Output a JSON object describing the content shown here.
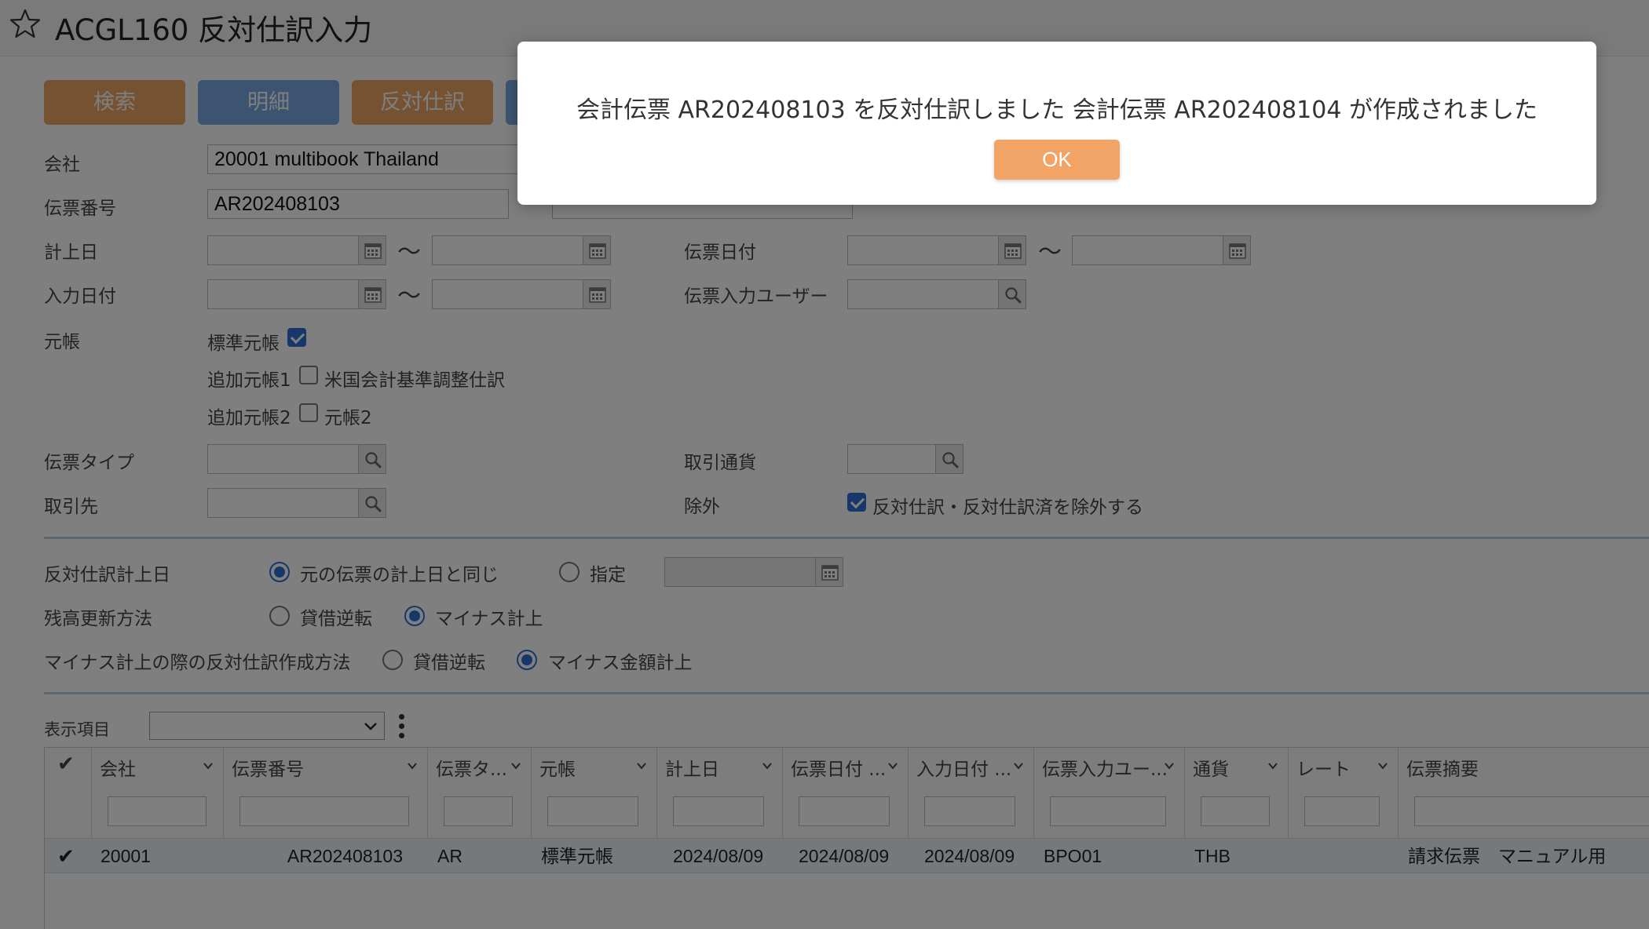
{
  "header": {
    "title": "ACGL160 反対仕訳入力"
  },
  "toolbar": {
    "search": "検索",
    "detail": "明細",
    "reverse": "反対仕訳"
  },
  "form": {
    "company_label": "会社",
    "company_value": "20001 multibook Thailand",
    "voucher_no_label": "伝票番号",
    "voucher_no_value": "AR202408103",
    "posting_date_label": "計上日",
    "entry_date_label": "入力日付",
    "voucher_date_label": "伝票日付",
    "entry_user_label": "伝票入力ユーザー",
    "ledger_label": "元帳",
    "ledgers": [
      {
        "name": "標準元帳",
        "checked": true,
        "desc": ""
      },
      {
        "name": "追加元帳1",
        "checked": false,
        "desc": "米国会計基準調整仕訳"
      },
      {
        "name": "追加元帳2",
        "checked": false,
        "desc": "元帳2"
      }
    ],
    "voucher_type_label": "伝票タイプ",
    "partner_label": "取引先",
    "currency_label": "取引通貨",
    "exclude_label": "除外",
    "exclude_option": "反対仕訳・反対仕訳済を除外する",
    "tilde": "〜"
  },
  "reverse_settings": {
    "date_label": "反対仕訳計上日",
    "date_same": "元の伝票の計上日と同じ",
    "date_specify": "指定",
    "balance_label": "残高更新方法",
    "balance_dc": "貸借逆転",
    "balance_minus": "マイナス計上",
    "minus_method_label": "マイナス計上の際の反対仕訳作成方法",
    "minus_dc": "貸借逆転",
    "minus_amount": "マイナス金額計上"
  },
  "display": {
    "label": "表示項目"
  },
  "grid": {
    "check_mark": "✔",
    "columns": [
      "会社",
      "伝票番号",
      "伝票タ...",
      "元帳",
      "計上日",
      "伝票日付 ...",
      "入力日付 ...",
      "伝票入力ユー...",
      "通貨",
      "レート",
      "伝票摘要"
    ],
    "rows": [
      {
        "company": "20001",
        "voucher_no": "AR202408103",
        "type": "AR",
        "ledger": "標準元帳",
        "posting_date": "2024/08/09",
        "voucher_date": "2024/08/09",
        "entry_date": "2024/08/09",
        "user": "BPO01",
        "currency": "THB",
        "rate": "",
        "summary": "請求伝票　マニュアル用"
      }
    ]
  },
  "modal": {
    "message": "会計伝票 AR202408103 を反対仕訳しました 会計伝票 AR202408104 が作成されました",
    "ok_label": "OK"
  },
  "colors": {
    "orange_button": "#e8a465",
    "blue_button": "#79a8e0",
    "check_blue": "#2f6fd6",
    "ok_button": "#f2a466"
  }
}
